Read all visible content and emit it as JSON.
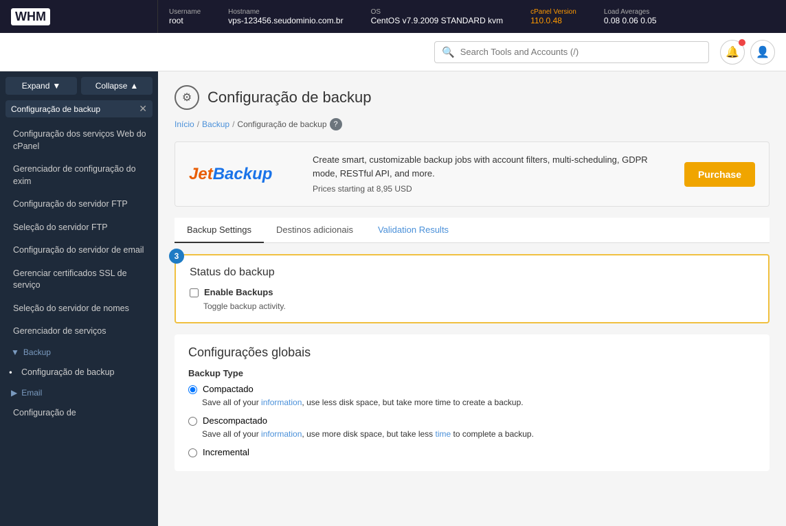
{
  "topbar": {
    "logo": "WHM",
    "username_label": "Username",
    "username_value": "root",
    "hostname_label": "Hostname",
    "hostname_value": "vps-123456.seudominio.com.br",
    "os_label": "OS",
    "os_value": "CentOS v7.9.2009 STANDARD kvm",
    "cpanel_version_label": "cPanel Version",
    "cpanel_version_value": "110.0.48",
    "load_averages_label": "Load Averages",
    "load_avg_values": "0.08  0.06  0.05"
  },
  "sidebar": {
    "expand_label": "Expand",
    "collapse_label": "Collapse",
    "search_placeholder": "Configuração de backup",
    "items": [
      {
        "label": "Configuração dos serviços Web do cPanel"
      },
      {
        "label": "Gerenciador de configuração do exim"
      },
      {
        "label": "Configuração do servidor FTP"
      },
      {
        "label": "Seleção do servidor FTP"
      },
      {
        "label": "Configuração do servidor de email"
      },
      {
        "label": "Gerenciar certificados SSL de serviço"
      },
      {
        "label": "Seleção do servidor de nomes"
      },
      {
        "label": "Gerenciador de serviços"
      }
    ],
    "section_backup": "Backup",
    "section_email": "Email",
    "active_item": "Configuração de backup",
    "last_item": "Configuração de"
  },
  "page": {
    "title": "Configuração de backup",
    "breadcrumb_home": "Início",
    "breadcrumb_backup": "Backup",
    "breadcrumb_current": "Configuração de backup"
  },
  "jetbackup": {
    "logo_text": "JetBackup",
    "description": "Create smart, customizable backup jobs with account filters, multi-scheduling, GDPR mode, RESTful API, and more.",
    "price_text": "Prices starting at 8,95 USD",
    "purchase_label": "Purchase"
  },
  "tabs": [
    {
      "label": "Backup Settings",
      "active": true
    },
    {
      "label": "Destinos adicionais",
      "active": false
    },
    {
      "label": "Validation Results",
      "active": false,
      "blue": true
    }
  ],
  "status_section": {
    "badge": "3",
    "title": "Status do backup",
    "checkbox_label": "Enable Backups",
    "checkbox_desc": "Toggle backup activity."
  },
  "global_section": {
    "title": "Configurações globais",
    "field_label": "Backup Type",
    "options": [
      {
        "value": "compactado",
        "label": "Compactado",
        "desc": "Save all of your information, use less disk space, but take more time to create a backup.",
        "checked": true
      },
      {
        "value": "descompactado",
        "label": "Descompactado",
        "desc": "Save all of your information, use more disk space, but take less time to complete a backup.",
        "checked": false
      },
      {
        "value": "incremental",
        "label": "Incremental",
        "desc": "",
        "checked": false
      }
    ]
  },
  "search": {
    "placeholder": "Search Tools and Accounts (/)"
  }
}
